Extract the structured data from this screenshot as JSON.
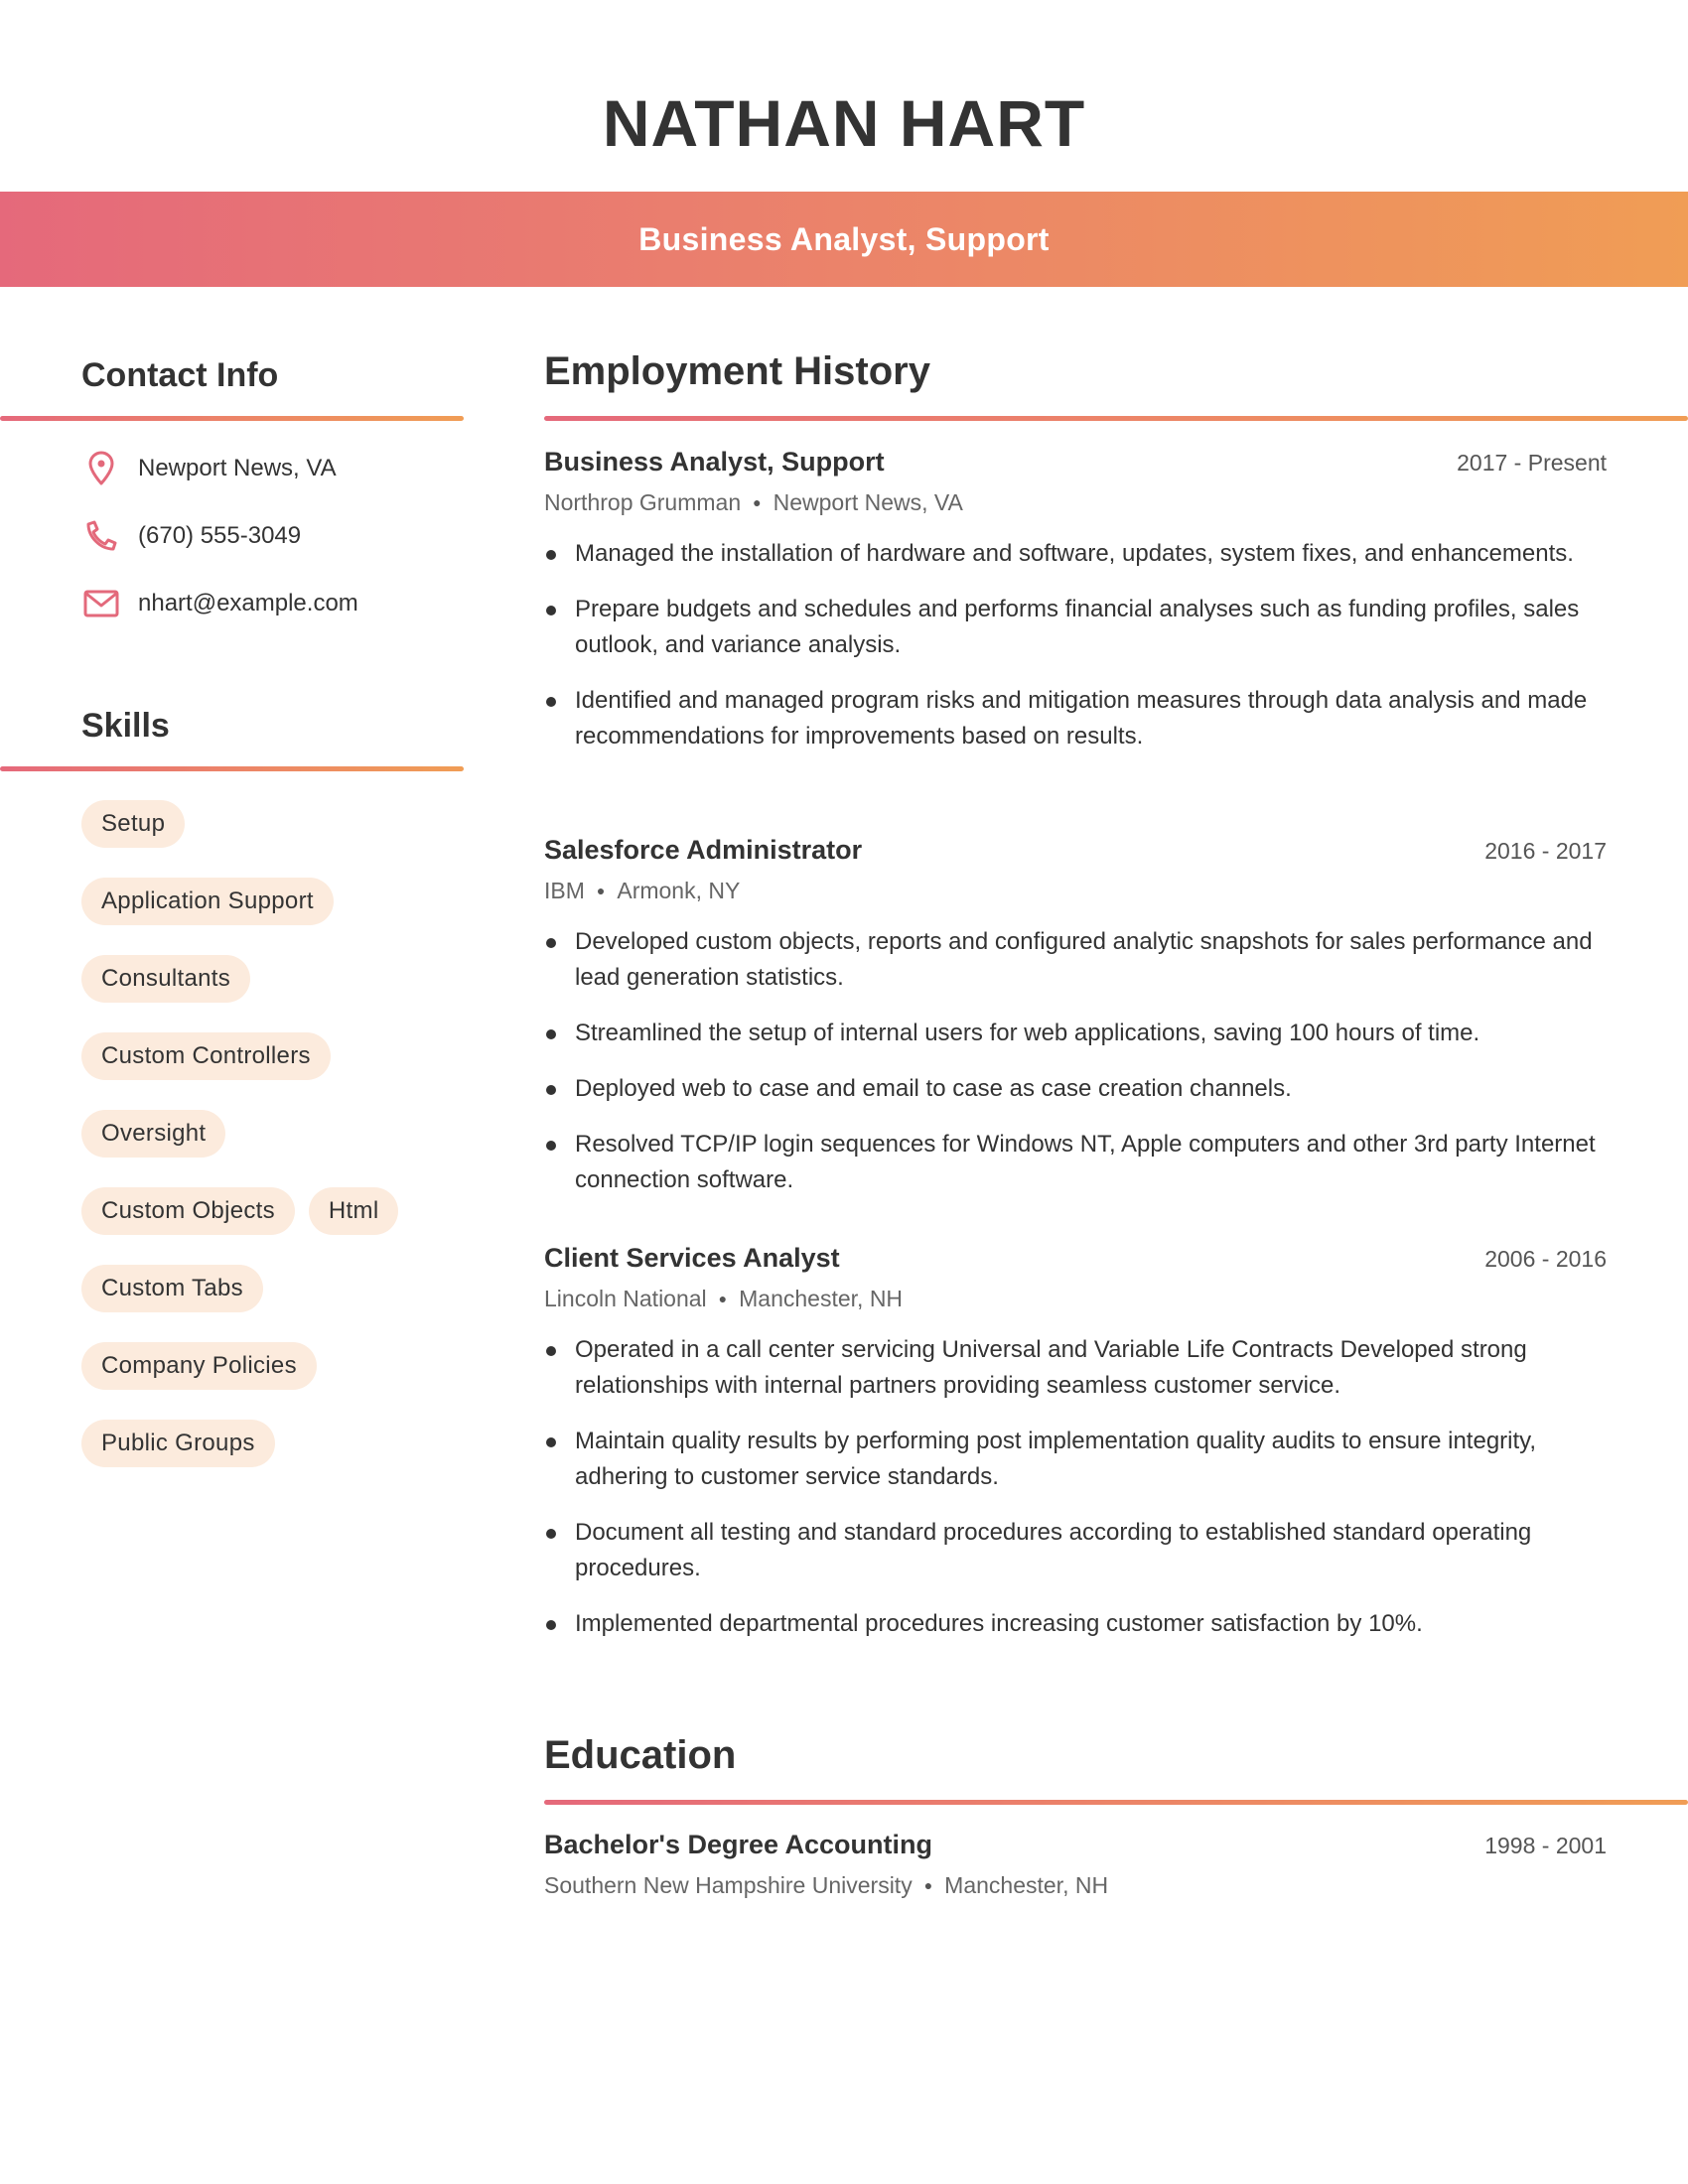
{
  "header": {
    "name": "NATHAN HART",
    "title": "Business Analyst, Support",
    "gradient_start": "#E5697B",
    "gradient_end": "#F09D55"
  },
  "contact": {
    "heading": "Contact Info",
    "items": [
      {
        "icon": "map-pin-icon",
        "text": "Newport News, VA"
      },
      {
        "icon": "phone-icon",
        "text": "(670) 555-3049"
      },
      {
        "icon": "mail-icon",
        "text": "nhart@example.com"
      }
    ],
    "icon_color": "#E3697B"
  },
  "skills": {
    "heading": "Skills",
    "items": [
      "Setup",
      "Application Support",
      "Consultants",
      "Custom Controllers",
      "Oversight",
      "Custom Objects",
      "Html",
      "Custom Tabs",
      "Company Policies",
      "Public Groups"
    ],
    "pill_color": "#FCEBDD"
  },
  "employment": {
    "heading": "Employment History",
    "jobs": [
      {
        "title": "Business Analyst, Support",
        "dates": "2017 - Present",
        "company": "Northrop Grumman",
        "location": "Newport News, VA",
        "bullets": [
          "Managed the installation of hardware and software, updates, system fixes, and enhancements.",
          "Prepare budgets and schedules and performs financial analyses such as funding profiles, sales outlook, and variance analysis.",
          "Identified and managed program risks and mitigation measures through data analysis and made recommendations for improvements based on results."
        ]
      },
      {
        "title": "Salesforce Administrator",
        "dates": "2016 - 2017",
        "company": "IBM",
        "location": "Armonk, NY",
        "bullets": [
          "Developed custom objects, reports and configured analytic snapshots for sales performance and lead generation statistics.",
          "Streamlined the setup of internal users for web applications, saving 100 hours of time.",
          "Deployed web to case and email to case as case creation channels.",
          "Resolved TCP/IP login sequences for Windows NT, Apple computers and other 3rd party Internet connection software."
        ]
      },
      {
        "title": "Client Services Analyst",
        "dates": "2006 - 2016",
        "company": "Lincoln National",
        "location": "Manchester, NH",
        "bullets": [
          "Operated in a call center servicing Universal and Variable Life Contracts Developed strong relationships with internal partners providing seamless customer service.",
          "Maintain quality results by performing post implementation quality audits to ensure integrity, adhering to customer service standards.",
          "Document all testing and standard procedures according to established standard operating procedures.",
          "Implemented departmental procedures increasing customer satisfaction by 10%."
        ]
      }
    ]
  },
  "education": {
    "heading": "Education",
    "entries": [
      {
        "degree": "Bachelor's Degree Accounting",
        "dates": "1998 - 2001",
        "school": "Southern New Hampshire University",
        "location": "Manchester, NH"
      }
    ]
  }
}
